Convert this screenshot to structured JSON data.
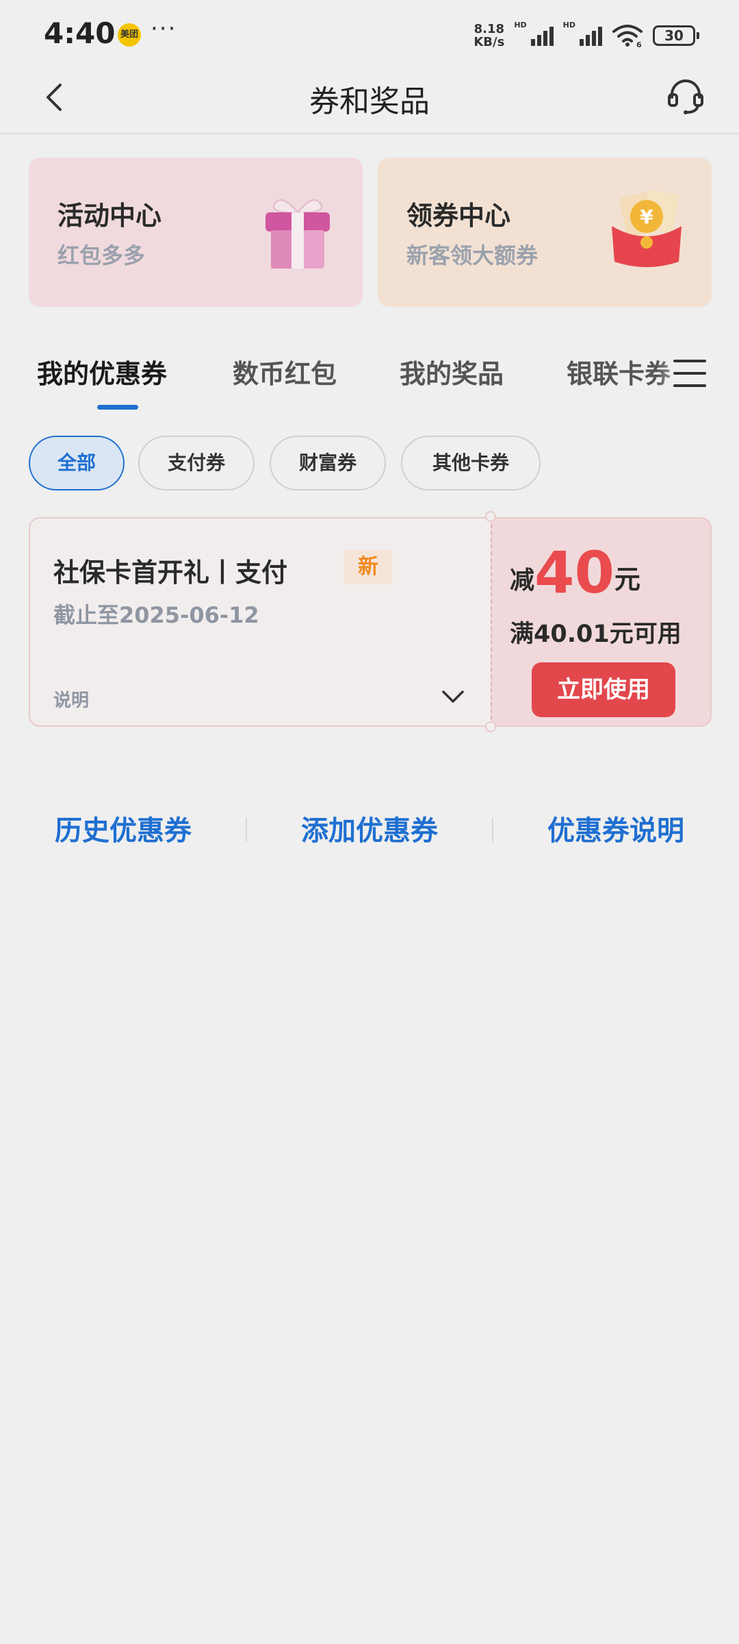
{
  "status_bar": {
    "time": "4:40",
    "app_badge": "美团",
    "more": "···",
    "net_speed_value": "8.18",
    "net_speed_unit": "KB/s",
    "network_1_label": "HD",
    "network_2_label": "HD",
    "wifi_badge": "6",
    "battery": "30"
  },
  "header": {
    "title": "券和奖品",
    "back_icon": "chevron-left-icon",
    "service_icon": "headset-icon"
  },
  "promos": [
    {
      "title": "活动中心",
      "subtitle": "红包多多",
      "icon": "gift-box-icon"
    },
    {
      "title": "领券中心",
      "subtitle": "新客领大额券",
      "icon": "red-envelope-icon"
    }
  ],
  "tabs": {
    "items": [
      "我的优惠券",
      "数币红包",
      "我的奖品",
      "银联卡券"
    ],
    "active_index": 0,
    "menu_icon": "menu-icon"
  },
  "filters": {
    "items": [
      "全部",
      "支付券",
      "财富券",
      "其他卡券"
    ],
    "active_index": 0
  },
  "coupon": {
    "title": "社保卡首开礼丨支付",
    "badge": "新",
    "expiry": "截止至2025-06-12",
    "description_label": "说明",
    "amount_prefix": "减",
    "amount": "40",
    "amount_unit": "元",
    "condition": "满40.01元可用",
    "use_button": "立即使用"
  },
  "links": {
    "history": "历史优惠券",
    "add": "添加优惠券",
    "help": "优惠券说明"
  },
  "colors": {
    "accent_blue": "#1f6fd1",
    "coupon_red": "#e94b4e",
    "badge_orange": "#f08a1e",
    "background": "#efefef"
  }
}
